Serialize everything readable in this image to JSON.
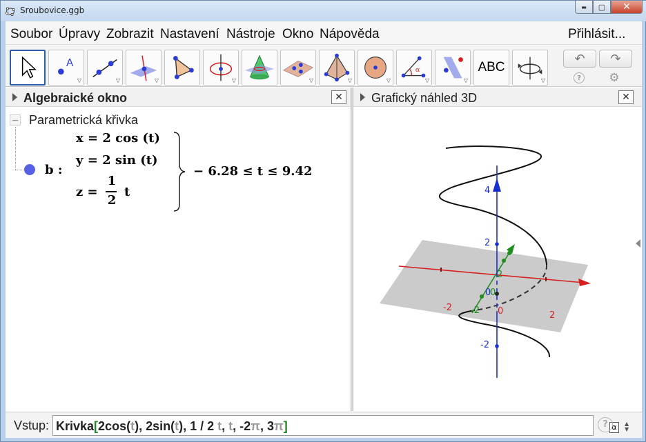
{
  "window": {
    "title": "Sroubovice.ggb",
    "minimize": "▬",
    "maximize": "▢",
    "close": "✕"
  },
  "menu": {
    "items": [
      "Soubor",
      "Úpravy",
      "Zobrazit",
      "Nastavení",
      "Nástroje",
      "Okno",
      "Nápověda"
    ],
    "login": "Přihlásit..."
  },
  "toolbar": {
    "text_tool_label": "ABC",
    "undo": "↶",
    "redo": "↷",
    "help": "?",
    "settings": "⚙"
  },
  "algebra": {
    "title": "Algebraické okno",
    "close": "✕",
    "category": "Parametrická křivka",
    "object_name": "b :",
    "eq_x": "x = 2  cos (t)",
    "eq_y": "y = 2  sin (t)",
    "eq_z_prefix": "z =",
    "eq_z_num": "1",
    "eq_z_den": "2",
    "eq_z_suffix": "t",
    "range": "− 6.28 ≤ t ≤ 9.42",
    "object_color": "#5860e6"
  },
  "graphics3d": {
    "title": "Grafický náhled 3D",
    "close": "✕",
    "z_ticks": [
      "4",
      "2",
      "-2"
    ],
    "origin_labels": [
      "0",
      "0",
      "0"
    ],
    "x_ticks": [
      "-2",
      "2"
    ],
    "y_ticks": [
      "-2",
      "2"
    ],
    "colors": {
      "x_axis": "#d62020",
      "y_axis": "#1e8e1e",
      "z_axis": "#1a2fd0",
      "plane": "#a0a0a0",
      "curve": "#111111"
    }
  },
  "input": {
    "label": "Vstup:",
    "cmd": "Krivka",
    "open_bracket": "[",
    "p1": "2cos(",
    "t1": "t",
    "p2": "), 2sin(",
    "t2": "t",
    "p3": "), 1 / 2 ",
    "t3": "t",
    "p4": ", ",
    "t4": "t",
    "p5": ", -2",
    "pi1": "π",
    "p6": ", 3",
    "pi2": "π",
    "close_bracket": "]",
    "alpha": "α",
    "help": "?"
  }
}
